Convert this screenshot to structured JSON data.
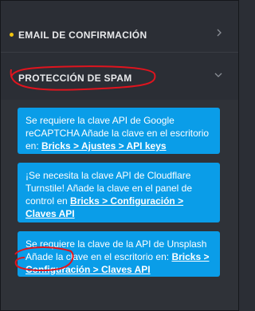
{
  "sections": {
    "email": {
      "title": "EMAIL DE CONFIRMACIÓN"
    },
    "spam": {
      "title": "PROTECCIÓN DE SPAM"
    }
  },
  "messages": [
    {
      "text": "Se requiere la clave API de Google reCAPTCHA Añade la clave en el escritorio en: ",
      "link": "Bricks > Ajustes > API keys"
    },
    {
      "text": "¡Se necesita la clave API de Cloudflare Turnstile! Añade la clave en el panel de control en ",
      "link": "Bricks > Configuración > Claves API"
    },
    {
      "text": "Se requiere la clave de la API de Unsplash Añade la clave en el escritorio en: ",
      "link": "Bricks > Configuración > Claves API"
    }
  ],
  "colors": {
    "accent": "#0a9de8",
    "annotation": "#e0141e",
    "dot": "#f1c40f"
  },
  "icons": {
    "chevron_right": "chevron-right-icon",
    "chevron_down": "chevron-down-icon"
  }
}
